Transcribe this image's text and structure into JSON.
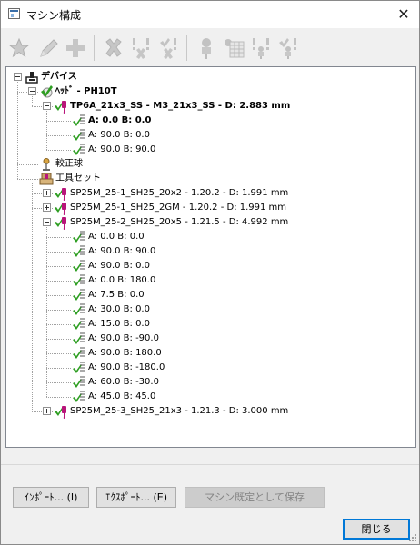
{
  "window": {
    "title": "マシン構成",
    "close_glyph": "✕"
  },
  "toolbar": {
    "buttons": [
      {
        "icon": "star-icon"
      },
      {
        "icon": "pencil-icon"
      },
      {
        "icon": "plus-icon"
      },
      {
        "icon": "delete-icon"
      },
      {
        "icon": "alert-x-icon"
      },
      {
        "icon": "check-x-icon"
      },
      {
        "icon": "probe-icon"
      },
      {
        "icon": "table-icon"
      },
      {
        "icon": "probe-alert-icon"
      },
      {
        "icon": "probe-check-icon"
      }
    ]
  },
  "tree": {
    "nodes": [
      {
        "label": "デバイス",
        "level": 0,
        "icon": "device-icon",
        "expander": "minus",
        "bold": true
      },
      {
        "label": "ﾍｯﾄﾞ - PH10T",
        "level": 1,
        "icon": "head-check-icon",
        "expander": "minus",
        "bold": true
      },
      {
        "label": "TP6A_21x3_SS - M3_21x3_SS - D:  2.883 mm",
        "level": 2,
        "icon": "probe-check-icon",
        "expander": "minus",
        "bold": true
      },
      {
        "label": "A:  0.0 B:  0.0",
        "level": 3,
        "icon": "tip-check-icon",
        "expander": "",
        "bold": true
      },
      {
        "label": "A: 90.0 B:  0.0",
        "level": 3,
        "icon": "tip-check-icon",
        "expander": "",
        "bold": false
      },
      {
        "label": "A: 90.0 B: 90.0",
        "level": 3,
        "icon": "tip-check-icon",
        "expander": "",
        "bold": false
      },
      {
        "label": "較正球",
        "level": 1,
        "icon": "sphere-icon",
        "expander": "",
        "bold": false
      },
      {
        "label": "工具セット",
        "level": 1,
        "icon": "toolset-icon",
        "expander": "",
        "bold": false
      },
      {
        "label": "SP25M_25-1_SH25_20x2 - 1.20.2 - D:  1.991 mm",
        "level": 2,
        "icon": "probe-check-icon",
        "expander": "plus",
        "bold": false
      },
      {
        "label": "SP25M_25-1_SH25_2GM - 1.20.2 - D:  1.991 mm",
        "level": 2,
        "icon": "probe-check-icon",
        "expander": "plus",
        "bold": false
      },
      {
        "label": "SP25M_25-2_SH25_20x5 - 1.21.5 - D:  4.992 mm",
        "level": 2,
        "icon": "probe-check-icon",
        "expander": "minus",
        "bold": false
      },
      {
        "label": "A:  0.0 B:  0.0",
        "level": 3,
        "icon": "tip-check-icon",
        "expander": "",
        "bold": false
      },
      {
        "label": "A: 90.0 B: 90.0",
        "level": 3,
        "icon": "tip-check-icon",
        "expander": "",
        "bold": false
      },
      {
        "label": "A: 90.0 B:  0.0",
        "level": 3,
        "icon": "tip-check-icon",
        "expander": "",
        "bold": false
      },
      {
        "label": "A:  0.0 B: 180.0",
        "level": 3,
        "icon": "tip-check-icon",
        "expander": "",
        "bold": false
      },
      {
        "label": "A:  7.5 B:  0.0",
        "level": 3,
        "icon": "tip-check-icon",
        "expander": "",
        "bold": false
      },
      {
        "label": "A: 30.0 B:  0.0",
        "level": 3,
        "icon": "tip-check-icon",
        "expander": "",
        "bold": false
      },
      {
        "label": "A: 15.0 B:  0.0",
        "level": 3,
        "icon": "tip-check-icon",
        "expander": "",
        "bold": false
      },
      {
        "label": "A: 90.0 B: -90.0",
        "level": 3,
        "icon": "tip-check-icon",
        "expander": "",
        "bold": false
      },
      {
        "label": "A: 90.0 B: 180.0",
        "level": 3,
        "icon": "tip-check-icon",
        "expander": "",
        "bold": false
      },
      {
        "label": "A: 90.0 B: -180.0",
        "level": 3,
        "icon": "tip-check-icon",
        "expander": "",
        "bold": false
      },
      {
        "label": "A: 60.0 B: -30.0",
        "level": 3,
        "icon": "tip-check-icon",
        "expander": "",
        "bold": false
      },
      {
        "label": "A: 45.0 B: 45.0",
        "level": 3,
        "icon": "tip-check-icon",
        "expander": "",
        "bold": false
      },
      {
        "label": "SP25M_25-3_SH25_21x3 - 1.21.3 - D:  3.000 mm",
        "level": 2,
        "icon": "probe-check-icon",
        "expander": "plus",
        "bold": false
      }
    ]
  },
  "buttons": {
    "import": "ｲﾝﾎﾟｰﾄ... (I)",
    "export": "ｴｸｽﾎﾟｰﾄ... (E)",
    "save_default": "マシン既定として保存",
    "close": "閉じる"
  },
  "colors": {
    "check_green": "#2e9e22",
    "probe_magenta": "#b8157a",
    "accent": "#0078d7"
  }
}
